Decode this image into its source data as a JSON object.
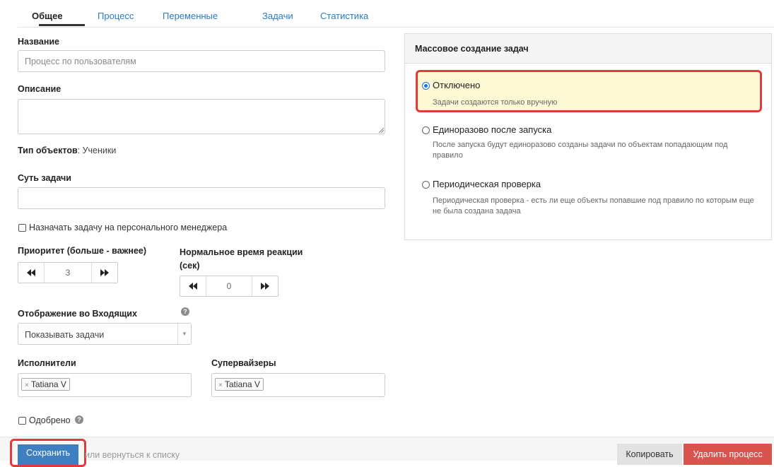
{
  "tabs": [
    "Общее",
    "Процесс",
    "Переменные",
    "Задачи",
    "Статистика"
  ],
  "form": {
    "name_label": "Название",
    "name_placeholder": "Процесс по пользователям",
    "description_label": "Описание",
    "description_value": "",
    "object_type_label": "Тип объектов",
    "object_type_value": ": Ученики",
    "task_essence_label": "Суть задачи",
    "task_essence_value": "",
    "assign_manager_label": "Назначать задачу на персонального менеджера",
    "assign_manager_checked": false,
    "priority_label": "Приоритет (больше - важнее)",
    "priority_value": "3",
    "reaction_label": "Нормальное время реакции (сек)",
    "reaction_value": "0",
    "inbox_label": "Отображение во Входящих",
    "inbox_help_icon": "question-circle-icon",
    "inbox_selected": "Показывать задачи",
    "executors_label": "Исполнители",
    "executors": [
      "Tatiana V"
    ],
    "supervisors_label": "Супервайзеры",
    "supervisors": [
      "Tatiana V"
    ],
    "approved_label": "Одобрено",
    "approved_checked": false
  },
  "mass_creation": {
    "title": "Массовое создание задач",
    "options": [
      {
        "label": "Отключено",
        "description": "Задачи создаются только вручную",
        "selected": true
      },
      {
        "label": "Единоразово после запуска",
        "description": "После запуска будут единоразово созданы задачи по объектам попадающим под правило",
        "selected": false
      },
      {
        "label": "Периодическая проверка",
        "description": "Периодическая проверка - есть ли еще объекты попавшие под правило по которым еще не была создана задача",
        "selected": false
      }
    ]
  },
  "footer": {
    "save_label": "Сохранить",
    "back_link": "или вернуться к списку",
    "copy_label": "Копировать",
    "delete_label": "Удалить процесс"
  },
  "colors": {
    "accent": "#2a7bc0",
    "highlight_border": "#e03a3a",
    "selected_bg": "#fdf9d5",
    "save_button": "#3d7fc0",
    "delete_button": "#d9534f"
  }
}
